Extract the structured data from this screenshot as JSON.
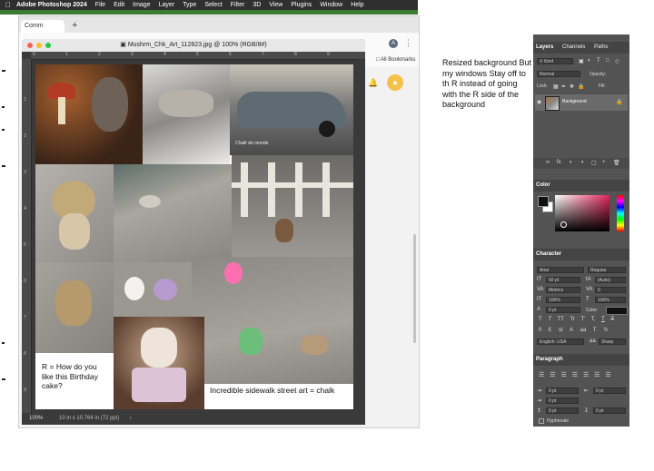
{
  "menubar": {
    "app_name": "Adobe Photoshop 2024",
    "items": [
      "File",
      "Edit",
      "Image",
      "Layer",
      "Type",
      "Select",
      "Filter",
      "3D",
      "View",
      "Plugins",
      "Window",
      "Help"
    ]
  },
  "browser": {
    "tab_label": "Comm",
    "bookmarks_label": "All Bookmarks",
    "avatar_letter": "A"
  },
  "document": {
    "title": "Mushrm_Chk_Art_112823.jpg @ 100% (RGB/8#)",
    "zoom": "100%",
    "doc_size": "10 in x 10.764 in (72 ppi)",
    "ruler_top": [
      "0",
      "1",
      "2",
      "3",
      "4",
      "5",
      "6",
      "7",
      "8",
      "9"
    ],
    "ruler_left": [
      "1",
      "2",
      "3",
      "4",
      "5",
      "6",
      "7",
      "8",
      "9"
    ]
  },
  "canvas": {
    "watermark_text": "Chalk de monde",
    "caption_left": "R  = How do you like this Birthday cake?",
    "caption_right": "Incredible sidewalk street art = chalk"
  },
  "note": {
    "text": "Resized background But my windows Stay off to th R instead of going with the R side of the background"
  },
  "layers_panel": {
    "tabs": [
      "Layers",
      "Channels",
      "Paths"
    ],
    "kind_label": "Kind",
    "blend_mode": "Normal",
    "opacity_label": "Opacity:",
    "lock_label": "Lock:",
    "fill_label": "Fill:",
    "layer_name": "Background"
  },
  "color_panel": {
    "title": "Color",
    "foreground_color": "#111111",
    "background_color": "#ffffff"
  },
  "character_panel": {
    "title": "Character",
    "font_family": "Arial",
    "font_style": "Regular",
    "font_size": "50 pt",
    "leading": "(Auto)",
    "kerning": "Metrics",
    "tracking": "0",
    "vertical_scale": "100%",
    "horizontal_scale": "100%",
    "baseline_shift": "0 pt",
    "color_label": "Color:",
    "language": "English: USA",
    "antialias": "Sharp",
    "style_buttons": [
      "T",
      "T",
      "TT",
      "Tr",
      "T'",
      "T,",
      "T",
      "T"
    ]
  },
  "paragraph_panel": {
    "title": "Paragraph",
    "indent_left": "0 pt",
    "indent_right": "0 pt",
    "indent_first": "0 pt",
    "space_before": "0 pt",
    "space_after": "0 pt",
    "hyphenate_label": "Hyphenate"
  }
}
